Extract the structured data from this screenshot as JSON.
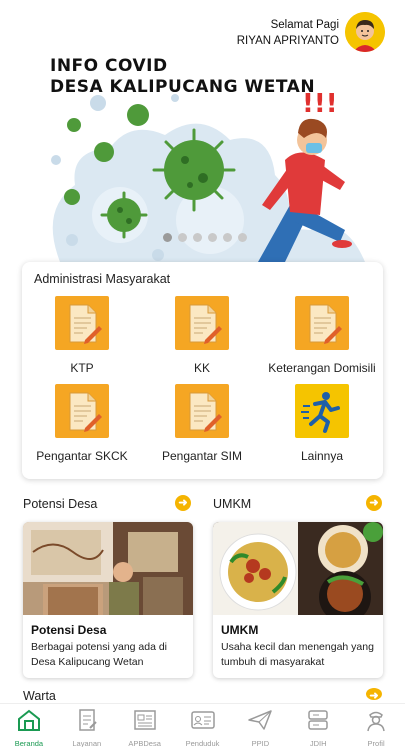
{
  "header": {
    "greeting": "Selamat Pagi",
    "user_name": "RIYAN APRIYANTO"
  },
  "banner": {
    "title_line1": "INFO COVID",
    "title_line2": "DESA KALIPUCANG WETAN",
    "slide_count": 6,
    "active_slide": 1
  },
  "admin": {
    "title": "Administrasi Masyarakat",
    "items": [
      {
        "label": "KTP",
        "icon": "document-icon"
      },
      {
        "label": "KK",
        "icon": "document-icon"
      },
      {
        "label": "Keterangan Domisili",
        "icon": "document-icon"
      },
      {
        "label": "Pengantar SKCK",
        "icon": "document-icon"
      },
      {
        "label": "Pengantar SIM",
        "icon": "document-icon"
      },
      {
        "label": "Lainnya",
        "icon": "running-person-icon"
      }
    ]
  },
  "sections": {
    "potensi": {
      "header": "Potensi Desa",
      "card_title": "Potensi Desa",
      "card_desc": "Berbagai potensi yang ada di Desa Kalipucang Wetan"
    },
    "umkm": {
      "header": "UMKM",
      "card_title": "UMKM",
      "card_desc": "Usaha kecil dan menengah yang tumbuh di masyarakat"
    },
    "warta": {
      "header": "Warta"
    }
  },
  "nav": {
    "items": [
      {
        "label": "Beranda",
        "icon": "home-icon",
        "active": true
      },
      {
        "label": "Layanan",
        "icon": "form-icon"
      },
      {
        "label": "APBDesa",
        "icon": "report-icon"
      },
      {
        "label": "Penduduk",
        "icon": "id-card-icon"
      },
      {
        "label": "PPID",
        "icon": "send-icon"
      },
      {
        "label": "JDIH",
        "icon": "server-icon"
      },
      {
        "label": "Profil",
        "icon": "officer-icon"
      }
    ]
  },
  "colors": {
    "accent": "#f5b400",
    "icon_bg": "#f5a623",
    "nav_active": "#1a9a52",
    "virus": "#4f9a3a"
  }
}
